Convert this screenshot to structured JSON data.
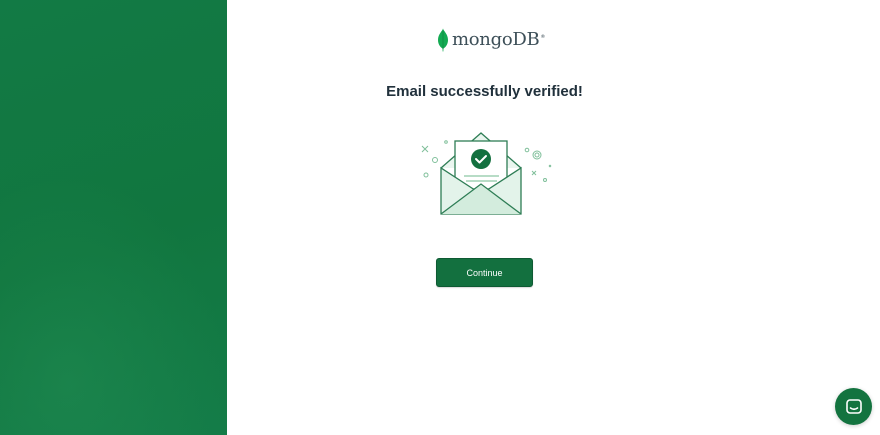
{
  "brand": {
    "logo_text": "mongoDB",
    "logo_mark": "®",
    "leaf_icon": "mongodb-leaf-icon"
  },
  "main": {
    "heading": "Email successfully verified!",
    "illustration_icon": "envelope-check-icon",
    "continue_label": "Continue"
  },
  "chat": {
    "icon": "chat-bubble-icon"
  },
  "colors": {
    "brand_green": "#13703f",
    "side_panel": "#127a45",
    "heading_text": "#21313c",
    "illustration_stroke": "#2e7d55",
    "illustration_fill": "#e3f3ea"
  }
}
